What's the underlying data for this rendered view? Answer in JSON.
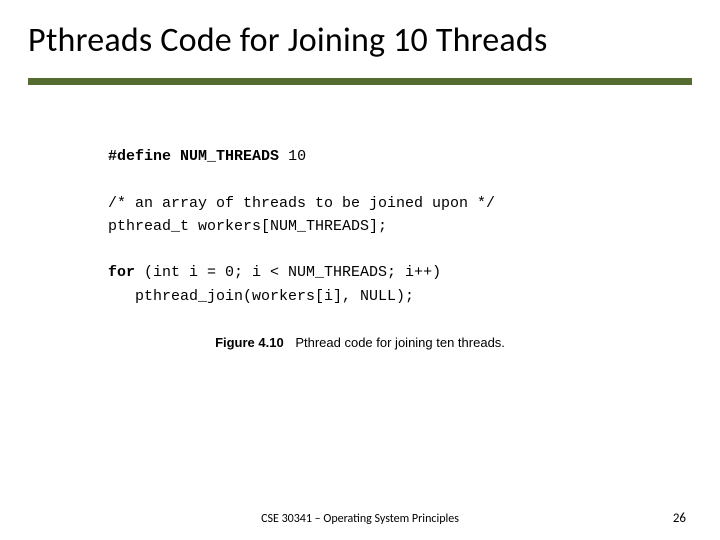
{
  "title": "Pthreads Code for Joining 10 Threads",
  "code": {
    "l1_define": "#define",
    "l1_numthreads": "NUM_THREADS",
    "l1_val": "10",
    "l2_comment": "/* an array of threads to be joined upon */",
    "l3": "pthread_t workers[NUM_THREADS];",
    "l4_for": "for",
    "l4_rest": " (int i = 0; i < NUM_THREADS; i++)",
    "l5": "   pthread_join(workers[i], NULL);"
  },
  "caption": {
    "figlabel": "Figure 4.10",
    "text": "Pthread code for joining ten threads."
  },
  "footer": {
    "course": "CSE 30341 – Operating System Principles",
    "page": "26"
  }
}
